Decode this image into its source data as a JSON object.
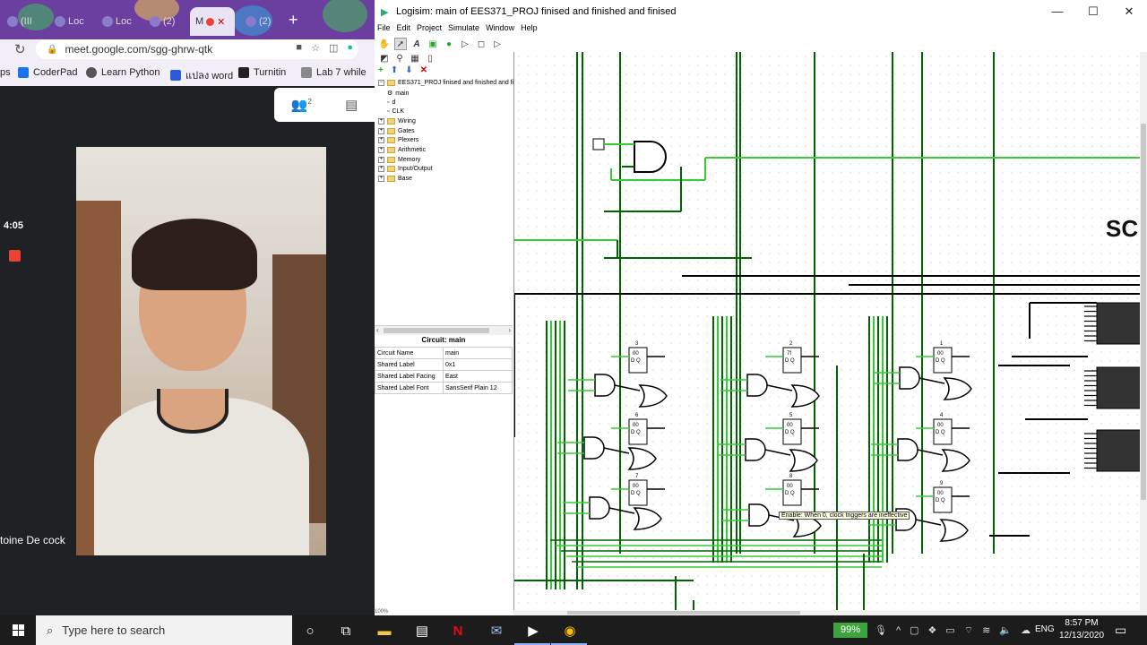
{
  "browser": {
    "tabs": [
      {
        "label": "(III"
      },
      {
        "label": "Loc"
      },
      {
        "label": "Loc"
      },
      {
        "label": "(2)"
      },
      {
        "label": "M",
        "active": true
      },
      {
        "label": "(2)"
      }
    ],
    "new_tab_label": "+",
    "url": "meet.google.com/sgg-ghrw-qtk",
    "bookmarks": [
      {
        "label": "CoderPad"
      },
      {
        "label": "Learn Python"
      },
      {
        "label": "แปลง word"
      },
      {
        "label": "Turnitin"
      },
      {
        "label": "Lab 7 while"
      }
    ],
    "bookmark_prefix": "ps"
  },
  "meet": {
    "time": "4:05",
    "participant_count": "2",
    "participant_name": "toine De cock"
  },
  "logisim": {
    "title": "Logisim: main of EES371_PROJ finised and finished and finised",
    "window_controls": {
      "minimize": "—",
      "maximize": "☐",
      "close": "✕"
    },
    "menu": [
      "File",
      "Edit",
      "Project",
      "Simulate",
      "Window",
      "Help"
    ],
    "project_root": "EES371_PROJ finised and finished and finise",
    "tree_circuits": [
      "main",
      "d",
      "CLK"
    ],
    "tree_libraries": [
      "Wiring",
      "Gates",
      "Plexers",
      "Arithmetic",
      "Memory",
      "Input/Output",
      "Base"
    ],
    "attr_title": "Circuit: main",
    "attributes": [
      {
        "name": "Circuit Name",
        "value": "main"
      },
      {
        "name": "Shared Label",
        "value": "0x1"
      },
      {
        "name": "Shared Label Facing",
        "value": "East"
      },
      {
        "name": "Shared Label Font",
        "value": "SansSerif Plain 12"
      }
    ],
    "zoom": "100%",
    "canvas_label": "SC",
    "tooltip": "Enable: When 0, clock triggers are ineffective",
    "flipflops": [
      {
        "label": "3",
        "top": "00",
        "pins": "D Q"
      },
      {
        "label": "2",
        "top": "7f",
        "pins": "D Q"
      },
      {
        "label": "1",
        "top": "00",
        "pins": "D Q"
      },
      {
        "label": "6",
        "top": "00",
        "pins": "D Q"
      },
      {
        "label": "5",
        "top": "00",
        "pins": "D Q"
      },
      {
        "label": "4",
        "top": "00",
        "pins": "D Q"
      },
      {
        "label": "7",
        "top": "00",
        "pins": "D Q"
      },
      {
        "label": "8",
        "top": "00",
        "pins": "D Q"
      },
      {
        "label": "9",
        "top": "00",
        "pins": "D Q"
      }
    ],
    "colors": {
      "wire_on": "#33cc33",
      "wire_off": "#006400",
      "wire_bus": "#000000"
    }
  },
  "taskbar": {
    "search_placeholder": "Type here to search",
    "battery": "99%",
    "language": "ENG",
    "time": "8:57 PM",
    "date": "12/13/2020"
  }
}
